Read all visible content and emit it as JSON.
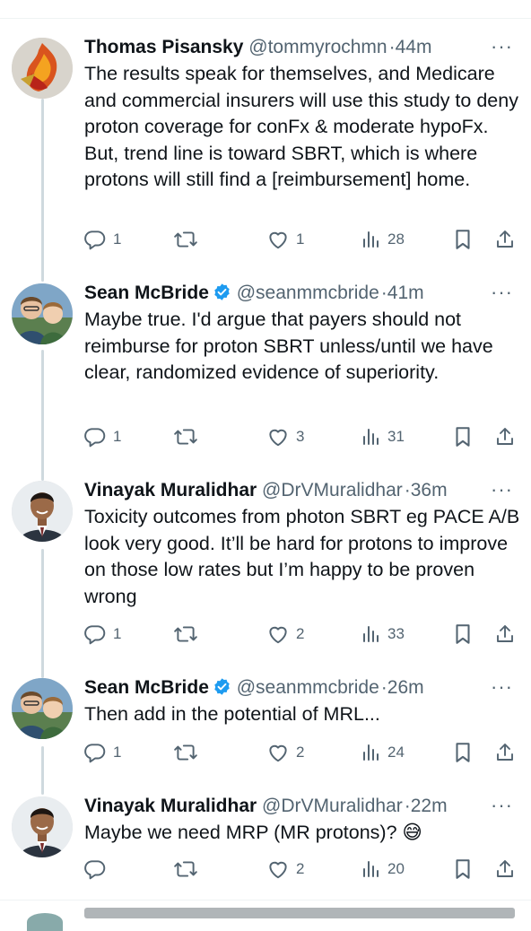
{
  "tweets": [
    {
      "name": "Thomas Pisansky",
      "verified": false,
      "handle": "@tommyrochmn",
      "separator": "·",
      "time": "44m",
      "text": "The results speak for themselves, and Medicare and commercial insurers will use this study to deny proton coverage for conFx & moderate hypoFx. But, trend line is toward SBRT, which is where protons will still find a [reimbursement] home.",
      "replies": "1",
      "retweets": "",
      "likes": "1",
      "views": "28",
      "avatar_icon": "flame-avatar"
    },
    {
      "name": "Sean McBride",
      "verified": true,
      "handle": "@seanmmcbride",
      "separator": "·",
      "time": "41m",
      "text": "Maybe true. I'd argue that payers should not reimburse for proton SBRT unless/until we have clear, randomized evidence of superiority.",
      "replies": "1",
      "retweets": "",
      "likes": "3",
      "views": "31",
      "avatar_icon": "two-people-avatar"
    },
    {
      "name": "Vinayak Muralidhar",
      "verified": false,
      "handle": "@DrVMuralidhar",
      "separator": "·",
      "time": "36m",
      "text": "Toxicity outcomes from photon SBRT eg PACE A/B look very good. It’ll be hard for protons to improve on those low rates but I’m happy to be proven wrong",
      "replies": "1",
      "retweets": "",
      "likes": "2",
      "views": "33",
      "avatar_icon": "man-suit-avatar"
    },
    {
      "name": "Sean McBride",
      "verified": true,
      "handle": "@seanmmcbride",
      "separator": "·",
      "time": "26m",
      "text": "Then add in the potential of MRL...",
      "replies": "1",
      "retweets": "",
      "likes": "2",
      "views": "24",
      "avatar_icon": "two-people-avatar"
    },
    {
      "name": "Vinayak Muralidhar",
      "verified": false,
      "handle": "@DrVMuralidhar",
      "separator": "·",
      "time": "22m",
      "text": "Maybe we need MRP (MR protons)? 😅",
      "replies": "",
      "retweets": "",
      "likes": "2",
      "views": "20",
      "avatar_icon": "man-suit-avatar"
    }
  ],
  "icons": {
    "reply": "reply-icon",
    "retweet": "retweet-icon",
    "like": "heart-icon",
    "views": "views-icon",
    "bookmark": "bookmark-icon",
    "share": "share-icon",
    "more": "more-icon"
  },
  "colors": {
    "text": "#0f1419",
    "secondary": "#536471",
    "verified": "#1d9bf0",
    "thread_line": "#cfd9de",
    "divider": "#eff3f4"
  },
  "more_glyph": "···"
}
